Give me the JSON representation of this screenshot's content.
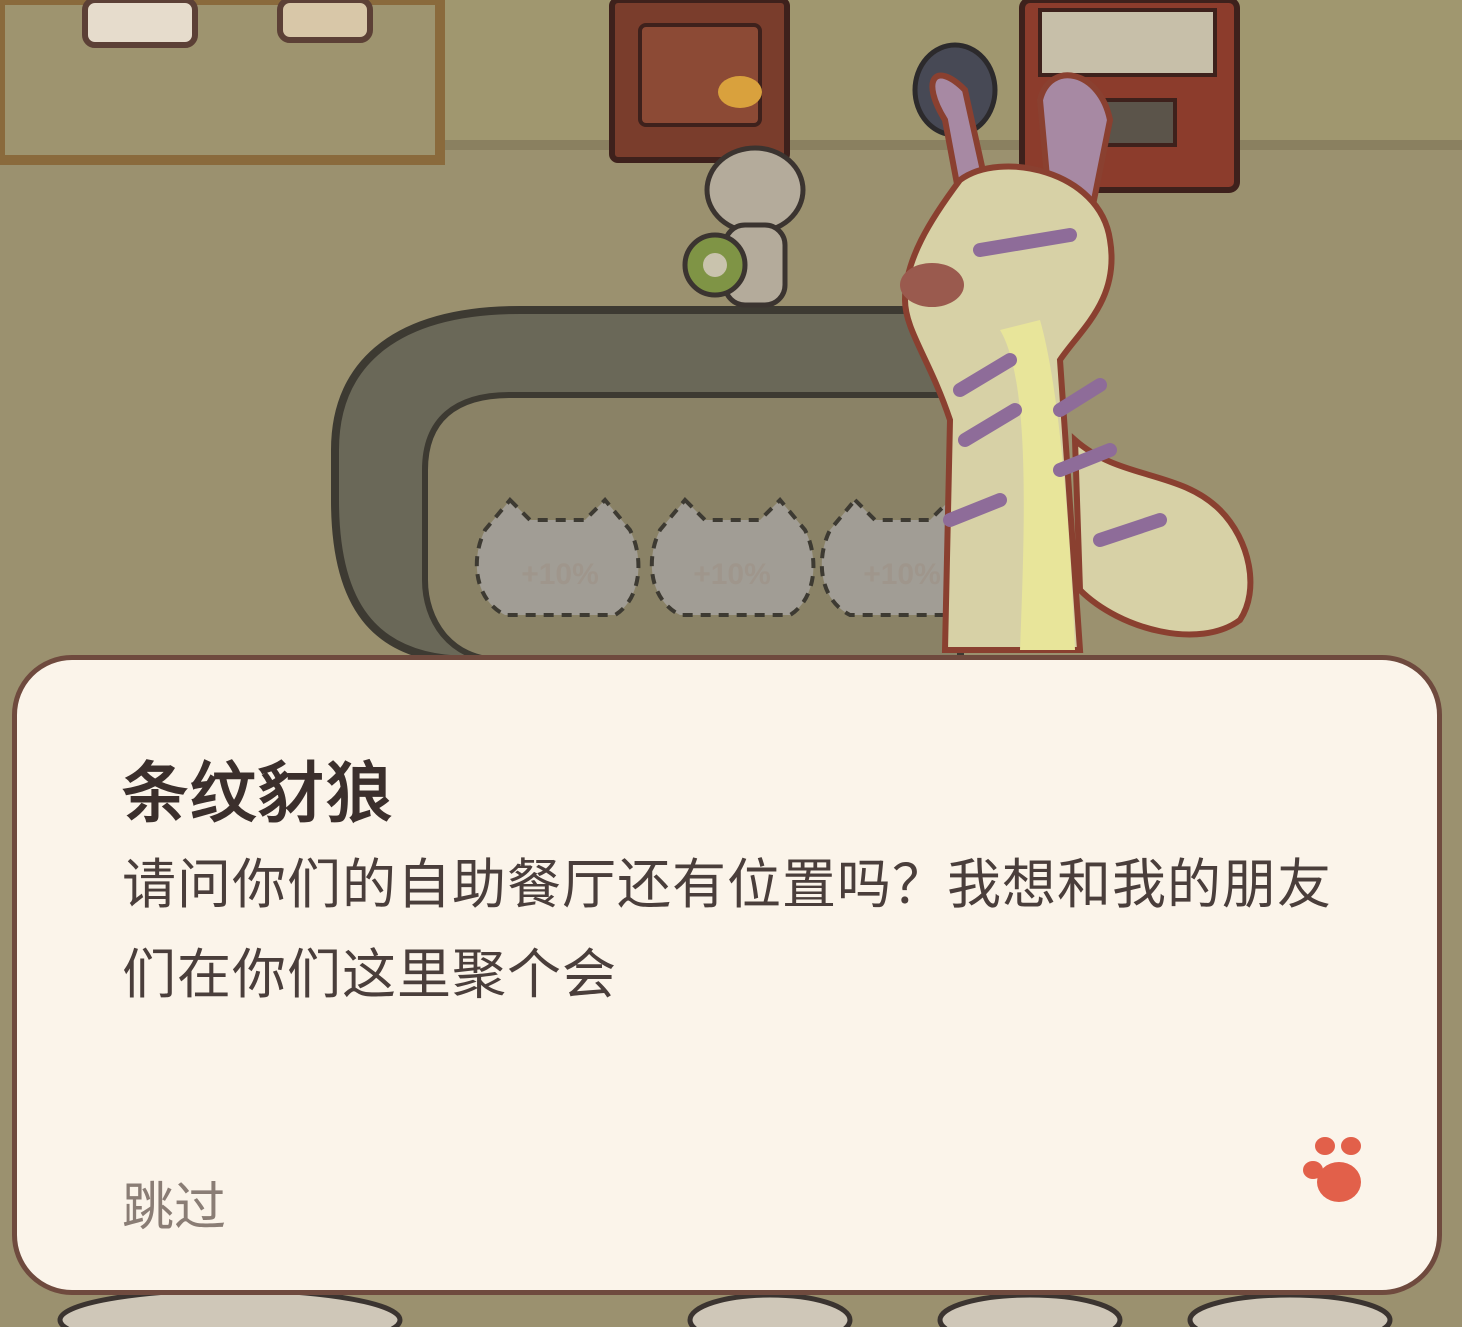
{
  "dialog": {
    "speaker": "条纹豺狼",
    "message": "请问你们的自助餐厅还有位置吗？我想和我的朋友们在你们这里聚个会",
    "skip_label": "跳过",
    "advance_icon": "paw-icon"
  },
  "conveyor": {
    "slots": [
      {
        "label": "+10%"
      },
      {
        "label": "+10%"
      },
      {
        "label": "+10%"
      }
    ]
  },
  "colors": {
    "dialog_bg": "#fbf4ea",
    "dialog_border": "#6f4a3e",
    "paw": "#e2604a"
  }
}
